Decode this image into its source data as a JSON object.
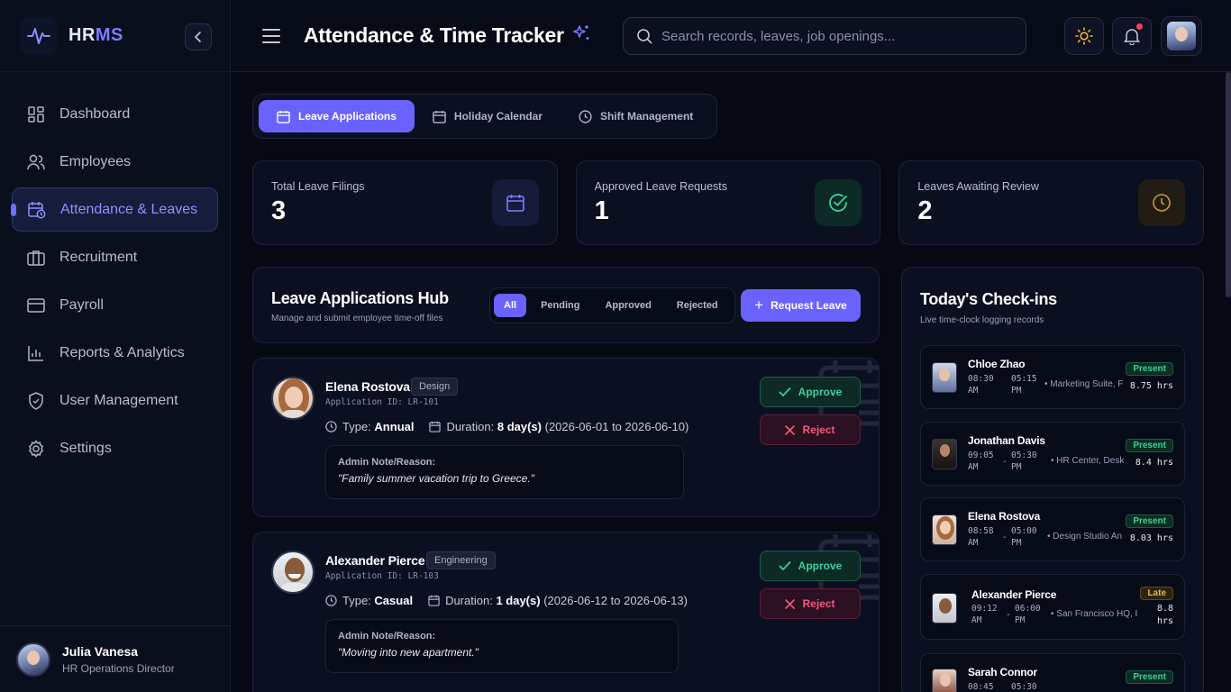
{
  "brand": {
    "name_a": "HR",
    "name_b": "MS"
  },
  "sidebar": {
    "items": [
      {
        "label": "Dashboard",
        "icon": "dashboard-grid-icon"
      },
      {
        "label": "Employees",
        "icon": "users-icon"
      },
      {
        "label": "Attendance & Leaves",
        "icon": "calendar-clock-icon",
        "active": true
      },
      {
        "label": "Recruitment",
        "icon": "briefcase-icon"
      },
      {
        "label": "Payroll",
        "icon": "credit-card-icon"
      },
      {
        "label": "Reports & Analytics",
        "icon": "bar-chart-icon"
      },
      {
        "label": "User Management",
        "icon": "shield-check-icon"
      },
      {
        "label": "Settings",
        "icon": "gear-icon"
      }
    ],
    "profile": {
      "name": "Julia Vanesa",
      "role": "HR Operations Director"
    }
  },
  "header": {
    "title": "Attendance & Time Tracker",
    "search_placeholder": "Search records, leaves, job openings..."
  },
  "tabs": [
    {
      "label": "Leave Applications",
      "active": true
    },
    {
      "label": "Holiday Calendar"
    },
    {
      "label": "Shift Management"
    }
  ],
  "stats": [
    {
      "label": "Total Leave Filings",
      "value": "3",
      "color": "#7b7cff"
    },
    {
      "label": "Approved Leave Requests",
      "value": "1",
      "color": "#3ad29a"
    },
    {
      "label": "Leaves Awaiting Review",
      "value": "2",
      "color": "#c99a2e"
    }
  ],
  "hub": {
    "title": "Leave Applications Hub",
    "subtitle": "Manage and submit employee time-off files",
    "filters": [
      "All",
      "Pending",
      "Approved",
      "Rejected"
    ],
    "request_label": "Request Leave"
  },
  "leaves": [
    {
      "name": "Elena Rostova",
      "dept": "Design",
      "app_id": "Application ID: LR-101",
      "type_label": "Type:",
      "type": "Annual",
      "duration_label": "Duration:",
      "duration": "8 day(s)",
      "range": "(2026-06-01 to 2026-06-10)",
      "note_label": "Admin Note/Reason:",
      "note": "\"Family summer vacation trip to Greece.\"",
      "approve": "Approve",
      "reject": "Reject"
    },
    {
      "name": "Alexander Pierce",
      "dept": "Engineering",
      "app_id": "Application ID: LR-103",
      "type_label": "Type:",
      "type": "Casual",
      "duration_label": "Duration:",
      "duration": "1 day(s)",
      "range": "(2026-06-12 to 2026-06-13)",
      "note_label": "Admin Note/Reason:",
      "note": "\"Moving into new apartment.\"",
      "approve": "Approve",
      "reject": "Reject"
    }
  ],
  "checkins": {
    "title": "Today's Check-ins",
    "subtitle": "Live time-clock logging records",
    "items": [
      {
        "name": "Chloe Zhao",
        "status": "Present",
        "in_t": "08:30",
        "in_p": "AM",
        "out_t": "05:15",
        "out_p": "PM",
        "loc": "Marketing Suite, F",
        "hrs": "8.75 hrs"
      },
      {
        "name": "Jonathan Davis",
        "status": "Present",
        "in_t": "09:05",
        "in_p": "AM",
        "out_t": "05:30",
        "out_p": "PM",
        "loc": "HR Center, Desk",
        "hrs": "8.4 hrs"
      },
      {
        "name": "Elena Rostova",
        "status": "Present",
        "in_t": "08:58",
        "in_p": "AM",
        "out_t": "05:00",
        "out_p": "PM",
        "loc": "Design Studio An",
        "hrs": "8.03 hrs"
      },
      {
        "name": "Alexander Pierce",
        "status": "Late",
        "in_t": "09:12",
        "in_p": "AM",
        "out_t": "06:00",
        "out_p": "PM",
        "loc": "San Francisco HQ, I",
        "hrs_a": "8.8",
        "hrs_b": "hrs"
      },
      {
        "name": "Sarah Connor",
        "status": "Present",
        "in_t": "08:45",
        "out_t": "05:30"
      }
    ],
    "dash": "-",
    "bullet": "•"
  }
}
